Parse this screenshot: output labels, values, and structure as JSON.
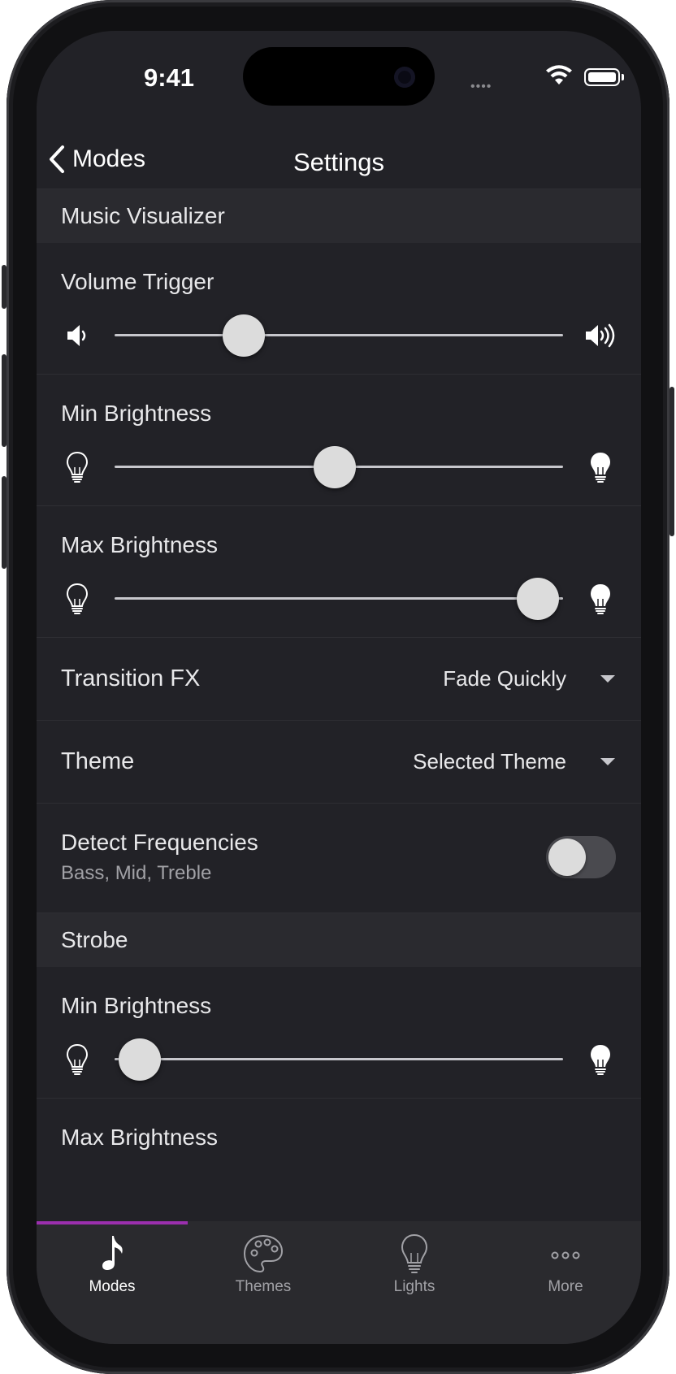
{
  "status_bar": {
    "time": "9:41",
    "signal_dots": "••••"
  },
  "nav": {
    "back_label": "Modes",
    "title": "Settings"
  },
  "sections": {
    "music_visualizer": {
      "header": "Music Visualizer",
      "volume_trigger": {
        "label": "Volume Trigger",
        "value_fraction": 0.28
      },
      "min_brightness": {
        "label": "Min Brightness",
        "value_fraction": 0.49
      },
      "max_brightness": {
        "label": "Max Brightness",
        "value_fraction": 0.96
      },
      "transition_fx": {
        "label": "Transition FX",
        "value": "Fade Quickly"
      },
      "theme": {
        "label": "Theme",
        "value": "Selected Theme"
      },
      "detect_frequencies": {
        "title": "Detect Frequencies",
        "subtitle": "Bass, Mid, Treble",
        "enabled": false
      }
    },
    "strobe": {
      "header": "Strobe",
      "min_brightness": {
        "label": "Min Brightness",
        "value_fraction": 0.04
      },
      "max_brightness": {
        "label": "Max Brightness"
      }
    }
  },
  "tabbar": {
    "tabs": [
      {
        "label": "Modes",
        "icon": "music-note-icon",
        "active": true
      },
      {
        "label": "Themes",
        "icon": "palette-icon",
        "active": false
      },
      {
        "label": "Lights",
        "icon": "lightbulb-icon",
        "active": false
      },
      {
        "label": "More",
        "icon": "more-icon",
        "active": false
      }
    ]
  },
  "colors": {
    "accent": "#9b2fae",
    "background": "#222227",
    "section_header": "#2a2a2f"
  }
}
